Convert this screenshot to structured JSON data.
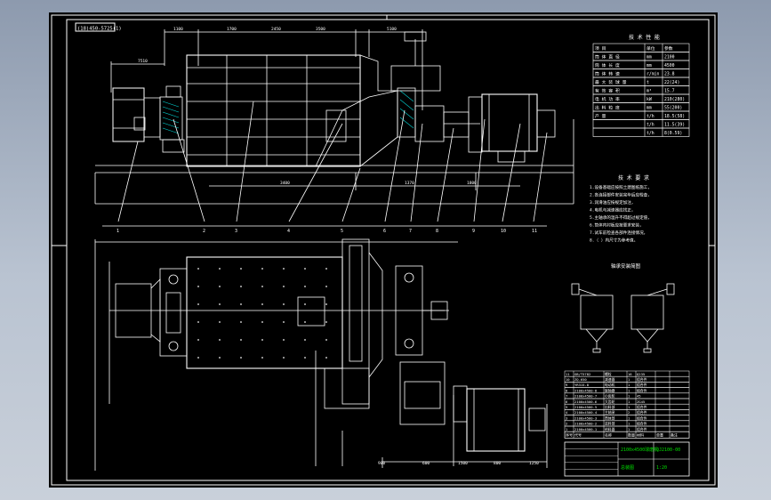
{
  "drawing": {
    "code_box": "(18)450-5725(1)",
    "tech_params_title": "技 术 性 能",
    "tech_params_header": [
      "项 目",
      "单位",
      "参数"
    ],
    "tech_params_rows": [
      [
        "筒 体 直 径",
        "mm",
        "2100"
      ],
      [
        "筒 体 长 度",
        "mm",
        "4500"
      ],
      [
        "筒 体 转 速",
        "r/min",
        "23.8"
      ],
      [
        "最 大 装 球 量",
        "t",
        "22(24)"
      ],
      [
        "有 效 容 积",
        "m³",
        "15.7"
      ],
      [
        "电 机 功 率",
        "kW",
        "210(280)"
      ],
      [
        "出 料 粒 度",
        "mm",
        "55(200)"
      ],
      [
        "产 量",
        "t/h",
        "18.5(58)"
      ],
      [
        "",
        "t/h",
        "11.5(39)"
      ],
      [
        "",
        "t/h",
        "8(0.59)"
      ]
    ],
    "tech_req_title": "技 术 要 求",
    "tech_req_lines": [
      "1.设备基础应按照土建图纸施工，",
      "2.各连接部件安装完毕后应检查，",
      "3.润滑油应按规定加注，",
      "4.电机与减速器应找正，",
      "5.主轴承的温升不得超过规定值，",
      "6.筒体内衬板应按要求安装，",
      "7.试车前检查各部件连接情况，",
      "8.（ ）内尺寸为参考值。"
    ],
    "bearing_title": "轴承安装简图",
    "balloons": [
      "1",
      "2",
      "3",
      "4",
      "5",
      "6",
      "7",
      "8",
      "9",
      "10",
      "11"
    ],
    "dimensions": [
      "1100",
      "1700",
      "2450",
      "3500",
      "5100",
      "7510",
      "1370",
      "1800",
      "900",
      "600",
      "1500",
      "800",
      "1250",
      "3400"
    ],
    "parts_rows": [
      [
        "11",
        "GB/T5782",
        "螺栓",
        "16",
        "Q235",
        "",
        ""
      ],
      [
        "10",
        "ZQ-650",
        "减速器",
        "1",
        "组合件",
        "",
        ""
      ],
      [
        "9",
        "YR315-8",
        "电动机",
        "1",
        "组合件",
        "",
        ""
      ],
      [
        "8",
        "2100x4500-8",
        "联轴器",
        "1",
        "组合件",
        "",
        ""
      ],
      [
        "7",
        "2100x4500-7",
        "小齿轮",
        "1",
        "45",
        "",
        ""
      ],
      [
        "6",
        "2100x4500-6",
        "大齿轮",
        "1",
        "ZG45",
        "",
        ""
      ],
      [
        "5",
        "2100x4500-5",
        "出料部",
        "1",
        "组合件",
        "",
        ""
      ],
      [
        "4",
        "2100x4500-4",
        "主轴承",
        "2",
        "组合件",
        "",
        ""
      ],
      [
        "3",
        "2100x4500-3",
        "筒体部",
        "1",
        "组合件",
        "",
        ""
      ],
      [
        "2",
        "2100x4500-2",
        "进料部",
        "1",
        "组合件",
        "",
        ""
      ],
      [
        "1",
        "2100x4500-1",
        "给料器",
        "1",
        "组合件",
        "",
        ""
      ]
    ],
    "parts_header": [
      "序号",
      "代号",
      "名称",
      "数量",
      "材料",
      "单重",
      "备注"
    ],
    "title_block": {
      "drawing_name": "2100x4500球磨机",
      "drawing_no": "QJ2100-00",
      "scale": "1:20",
      "sheet": "总装图"
    }
  },
  "colors": {
    "background": "#000000",
    "frame": "#ffffff",
    "outline": "#ffffff",
    "dimension": "#ffffff",
    "hatch": "#00d7d7",
    "title_green": "#00e000",
    "table_line": "#ffffff"
  }
}
